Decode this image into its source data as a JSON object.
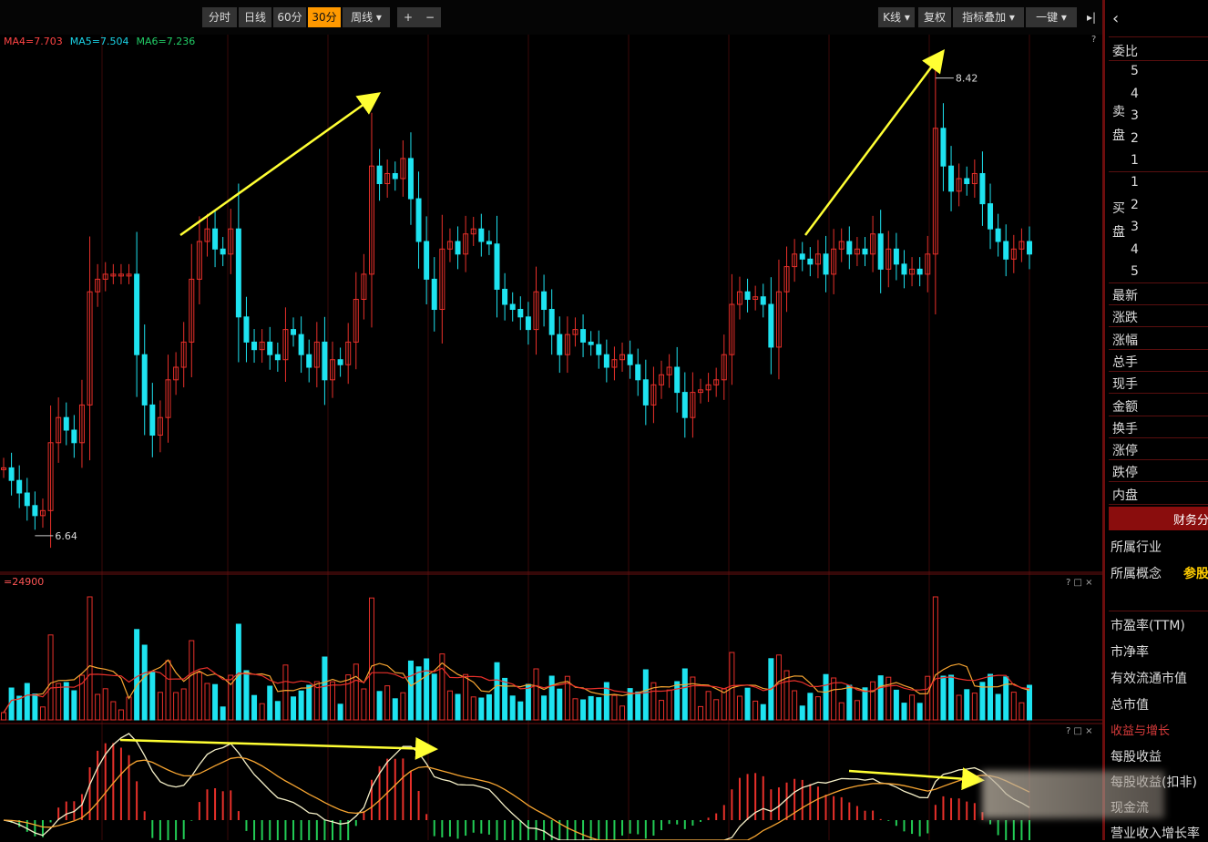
{
  "toolbar": {
    "left_buttons": [
      "分时",
      "日线",
      "60分",
      "30分",
      "周线 ▾"
    ],
    "selected_index": 3,
    "zoom_in": "+",
    "zoom_out": "−",
    "right_buttons": [
      "K线 ▾",
      "复权",
      "指标叠加 ▾",
      "一键 ▾"
    ],
    "back_icon": "chevron-left-icon",
    "collapse_icon": "collapse-icon"
  },
  "ma_legend": [
    {
      "label": "MA4=7.703",
      "color": "#ff4444"
    },
    {
      "label": "MA5=7.504",
      "color": "#1ad4e8"
    },
    {
      "label": "MA6=7.236",
      "color": "#22cc66"
    }
  ],
  "volume_legend": "=24900",
  "panel_controls": "? □ ×",
  "colors": {
    "up": "#e8302a",
    "down": "#1ee3f0",
    "grid": "#3a0808",
    "arrow": "#ffff33",
    "dif": "#f5f0c8",
    "dea": "#f7a531"
  },
  "chart_data": [
    {
      "type": "candlestick",
      "annotations": [
        {
          "label": "8.42",
          "kind": "high"
        },
        {
          "label": "6.64",
          "kind": "low"
        }
      ],
      "close_values": [
        6.85,
        6.8,
        6.75,
        6.7,
        6.66,
        6.68,
        6.95,
        7.05,
        7.0,
        6.95,
        7.1,
        7.55,
        7.6,
        7.62,
        7.62,
        7.62,
        7.62,
        7.3,
        7.1,
        6.98,
        7.05,
        7.2,
        7.25,
        7.35,
        7.6,
        7.75,
        7.8,
        7.72,
        7.7,
        7.8,
        7.45,
        7.35,
        7.32,
        7.35,
        7.3,
        7.28,
        7.4,
        7.38,
        7.3,
        7.25,
        7.35,
        7.2,
        7.28,
        7.26,
        7.35,
        7.52,
        7.62,
        8.05,
        7.98,
        8.02,
        8.0,
        8.08,
        7.92,
        7.75,
        7.6,
        7.48,
        7.72,
        7.75,
        7.7,
        7.78,
        7.8,
        7.75,
        7.74,
        7.56,
        7.5,
        7.48,
        7.45,
        7.4,
        7.55,
        7.48,
        7.38,
        7.3,
        7.38,
        7.4,
        7.35,
        7.34,
        7.3,
        7.25,
        7.28,
        7.3,
        7.26,
        7.2,
        7.1,
        7.18,
        7.22,
        7.25,
        7.15,
        7.05,
        7.15,
        7.16,
        7.18,
        7.2,
        7.3,
        7.5,
        7.55,
        7.52,
        7.53,
        7.5,
        7.33,
        7.55,
        7.65,
        7.7,
        7.68,
        7.66,
        7.7,
        7.62,
        7.72,
        7.75,
        7.7,
        7.72,
        7.7,
        7.78,
        7.64,
        7.72,
        7.66,
        7.62,
        7.64,
        7.62,
        7.7,
        8.2,
        8.05,
        7.95,
        8.0,
        7.98,
        8.02,
        7.9,
        7.8,
        7.75,
        7.68,
        7.72,
        7.75,
        7.7
      ]
    },
    {
      "type": "bar",
      "name": "volume"
    },
    {
      "type": "macd"
    }
  ],
  "right_panel": {
    "weibi_label": "委比",
    "sell_label": "卖盘",
    "buy_label": "买盘",
    "sell_levels": [
      "5",
      "4",
      "3",
      "2",
      "1"
    ],
    "buy_levels": [
      "1",
      "2",
      "3",
      "4",
      "5"
    ],
    "fields": [
      "最新",
      "涨跌",
      "涨幅",
      "总手",
      "现手",
      "金额",
      "换手",
      "涨停",
      "跌停",
      "内盘"
    ],
    "tab_label": "财务分",
    "industry": "所属行业",
    "concept": "所属概念",
    "concept_tag": "参股",
    "metrics": [
      "市盈率(TTM)",
      "市净率",
      "有效流通市值",
      "总市值"
    ],
    "section_title": "收益与增长",
    "metrics2": [
      "每股收益",
      "每股收益(扣非)",
      "现金流",
      "营业收入增长率"
    ]
  }
}
